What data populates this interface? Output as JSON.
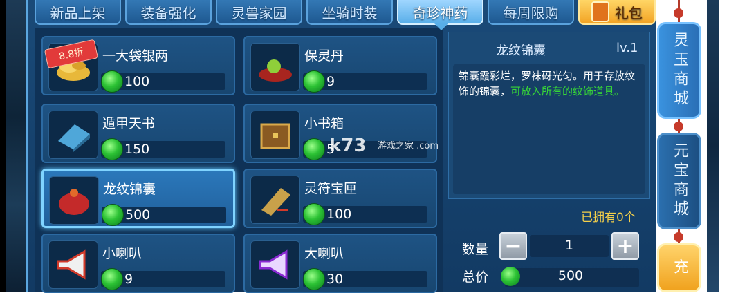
{
  "tabs": [
    {
      "label": "新品上架",
      "active": false
    },
    {
      "label": "装备强化",
      "active": false
    },
    {
      "label": "灵兽家园",
      "active": false
    },
    {
      "label": "坐骑时装",
      "active": false
    },
    {
      "label": "奇珍神药",
      "active": true
    },
    {
      "label": "每周限购",
      "active": false
    }
  ],
  "gift_tab": {
    "label": "礼包"
  },
  "items": [
    {
      "name": "一大袋银两",
      "price": "100",
      "badge": "8.8折",
      "icon": "silver-ingots-icon"
    },
    {
      "name": "保灵丹",
      "price": "9",
      "icon": "elixir-pill-icon"
    },
    {
      "name": "遁甲天书",
      "price": "150",
      "icon": "blue-book-icon"
    },
    {
      "name": "小书箱",
      "price": "5",
      "icon": "book-chest-icon"
    },
    {
      "name": "龙纹锦囊",
      "price": "500",
      "icon": "red-pouch-icon",
      "selected": true
    },
    {
      "name": "灵符宝匣",
      "price": "100",
      "icon": "talisman-box-icon"
    },
    {
      "name": "小喇叭",
      "price": "9",
      "icon": "small-horn-icon"
    },
    {
      "name": "大喇叭",
      "price": "30",
      "icon": "big-horn-icon"
    }
  ],
  "detail": {
    "title": "龙纹锦囊",
    "level": "lv.1",
    "desc_normal": "锦囊霞彩烂，罗袜砑光匀。用于存放纹饰的锦囊，",
    "desc_green": "可放入所有的纹饰道具。",
    "owned": "已拥有0个",
    "qty_label": "数量",
    "qty_value": "1",
    "minus": "−",
    "plus": "+",
    "total_label": "总价",
    "total_value": "500"
  },
  "side_buttons": {
    "jade": "灵玉商城",
    "yuanbao": "元宝商城",
    "charge": "充"
  },
  "watermark": {
    "main": "k73",
    "sub": "游戏之家 .com"
  },
  "colors": {
    "panel": "#123a63",
    "accent": "#58aee8",
    "gold": "#f5d04a",
    "green": "#37d637"
  }
}
